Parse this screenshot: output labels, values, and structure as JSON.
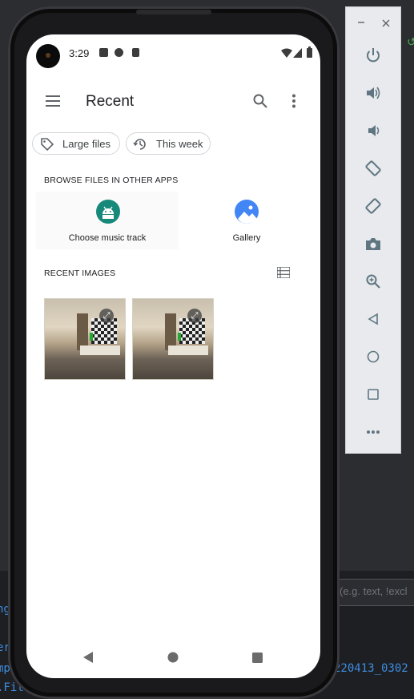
{
  "ide": {
    "hint_text": "(e.g. text, !excl",
    "code_right": "220413_0302",
    "code_left_lines": [
      "ng",
      "er",
      "mp",
      ".Fil"
    ]
  },
  "status_bar": {
    "time": "3:29"
  },
  "app_bar": {
    "menu_icon": "hamburger-menu-icon",
    "title": "Recent",
    "search_icon": "search-icon",
    "overflow_icon": "more-vert-icon"
  },
  "chips": [
    {
      "label": "Large files",
      "icon": "label-tag-icon"
    },
    {
      "label": "This week",
      "icon": "history-clock-icon"
    }
  ],
  "browse_section": {
    "header": "BROWSE FILES IN OTHER APPS",
    "apps": [
      {
        "label": "Choose music track",
        "icon": "android-icon",
        "color": "#17897a"
      },
      {
        "label": "Gallery",
        "icon": "gallery-icon",
        "color": "#4285f4"
      }
    ]
  },
  "recent_images": {
    "header": "RECENT IMAGES",
    "view_toggle_icon": "list-view-icon",
    "count": 2
  },
  "colors": {
    "accent_teal": "#17897a",
    "gallery_blue": "#4285f4",
    "panel_icon": "#5f7682"
  },
  "emulator_panel": {
    "window_controls": [
      "minimize-icon",
      "close-icon"
    ],
    "buttons": [
      "power-icon",
      "volume-up-icon",
      "volume-down-icon",
      "rotate-left-icon",
      "rotate-right-icon",
      "camera-icon",
      "zoom-icon",
      "back-icon",
      "home-icon",
      "overview-icon",
      "more-icon"
    ]
  }
}
